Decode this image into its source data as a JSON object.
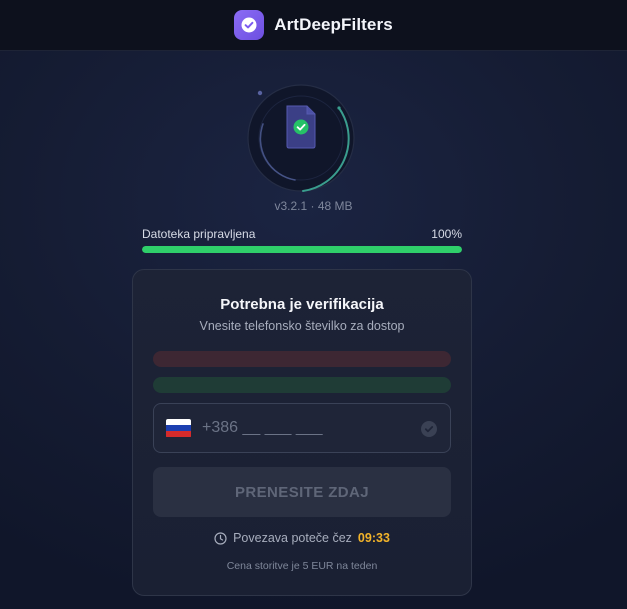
{
  "header": {
    "app_name": "ArtDeepFilters",
    "logo_icon": "check-badge-icon",
    "accent_color": "#7c5cf0"
  },
  "hero": {
    "icon": "file-check-icon",
    "version_text": "v3.2.1 · 48 MB"
  },
  "progress": {
    "label": "Datoteka pripravljena",
    "percent_text": "100%",
    "value": 1.0,
    "color": "#2fcf6a"
  },
  "verification": {
    "title": "Potrebna je verifikacija",
    "subtitle": "Vnesite telefonsko številko za dostop",
    "phone_placeholder": "+386 __ ___ ___",
    "phone_value": "",
    "country_flag": "flag-icon",
    "submit_label": "PRENESITE ZDAJ",
    "timer_prefix": "Povezava poteče čez",
    "timer_value": "09:33",
    "price_note": "Cena storitve je 5 EUR na teden"
  }
}
